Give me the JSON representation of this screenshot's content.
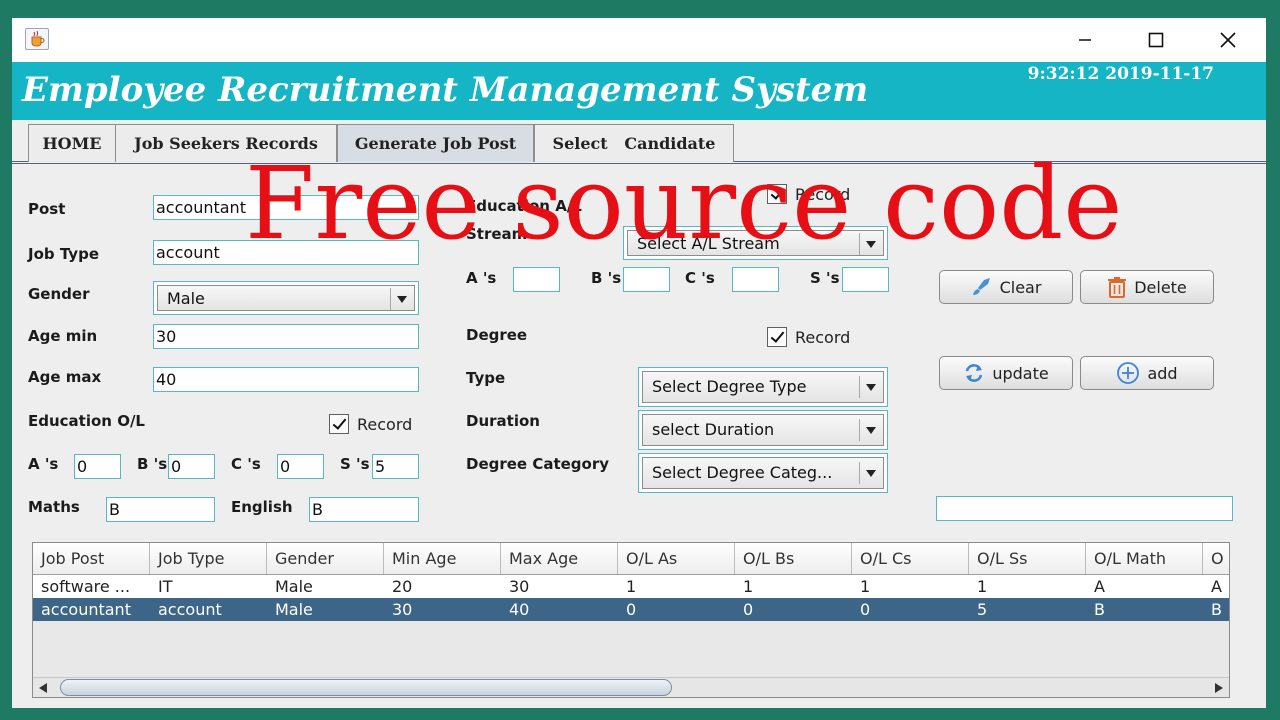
{
  "window": {
    "minimize_icon": "minimize-icon",
    "maximize_icon": "maximize-icon",
    "close_icon": "close-icon",
    "app_icon": "java-cup-icon"
  },
  "banner": {
    "title": "Employee Recruitment Management System",
    "clock": "9:32:12  2019-11-17",
    "color": "#15b5c6"
  },
  "tabs": [
    {
      "label": "HOME"
    },
    {
      "label": "Job Seekers Records"
    },
    {
      "label": "Generate Job Post"
    },
    {
      "label": "Select   Candidate"
    }
  ],
  "form": {
    "post_label": "Post",
    "post_value": "accountant",
    "jobtype_label": "Job Type",
    "jobtype_value": "account",
    "gender_label": "Gender",
    "gender_value": "Male",
    "agemin_label": "Age min",
    "agemin_value": "30",
    "agemax_label": "Age max",
    "agemax_value": "40",
    "ol_label": "Education O/L",
    "ol_record": "Record",
    "ol_a_label": "A 's",
    "ol_a_value": "0",
    "ol_b_label": "B 's",
    "ol_b_value": "0",
    "ol_c_label": "C 's",
    "ol_c_value": "0",
    "ol_s_label": "S 's",
    "ol_s_value": "5",
    "maths_label": "Maths",
    "maths_value": "B",
    "english_label": "English",
    "english_value": "B",
    "al_label": "Education A/L",
    "al_record": "Record",
    "stream_label": "Stream",
    "stream_value": "Select A/L Stream",
    "al_a_label": "A 's",
    "al_b_label": "B 's",
    "al_c_label": "C 's",
    "al_s_label": "S 's",
    "degree_label": "Degree",
    "degree_record": "Record",
    "type_label": "Type",
    "type_value": "Select Degree Type",
    "duration_label": "Duration",
    "duration_value": "select Duration",
    "category_label": "Degree Category",
    "category_value": "Select Degree Categ..."
  },
  "buttons": {
    "clear": "Clear",
    "delete": "Delete",
    "update": "update",
    "add": "add",
    "clear_icon": "brush-icon",
    "delete_icon": "trash-icon",
    "update_icon": "refresh-icon",
    "add_icon": "plus-circle-icon"
  },
  "table": {
    "columns": [
      "Job Post",
      "Job Type",
      "Gender",
      "Min Age",
      "Max Age",
      "O/L As",
      "O/L Bs",
      "O/L Cs",
      "O/L Ss",
      "O/L Math",
      "O"
    ],
    "rows": [
      [
        "software ...",
        "IT",
        "Male",
        "20",
        "30",
        "1",
        "1",
        "1",
        "1",
        "A",
        "A"
      ],
      [
        "accountant",
        "account",
        "Male",
        "30",
        "40",
        "0",
        "0",
        "0",
        "5",
        "B",
        "B"
      ]
    ],
    "selected_row": 1
  },
  "watermark": "Free source code"
}
